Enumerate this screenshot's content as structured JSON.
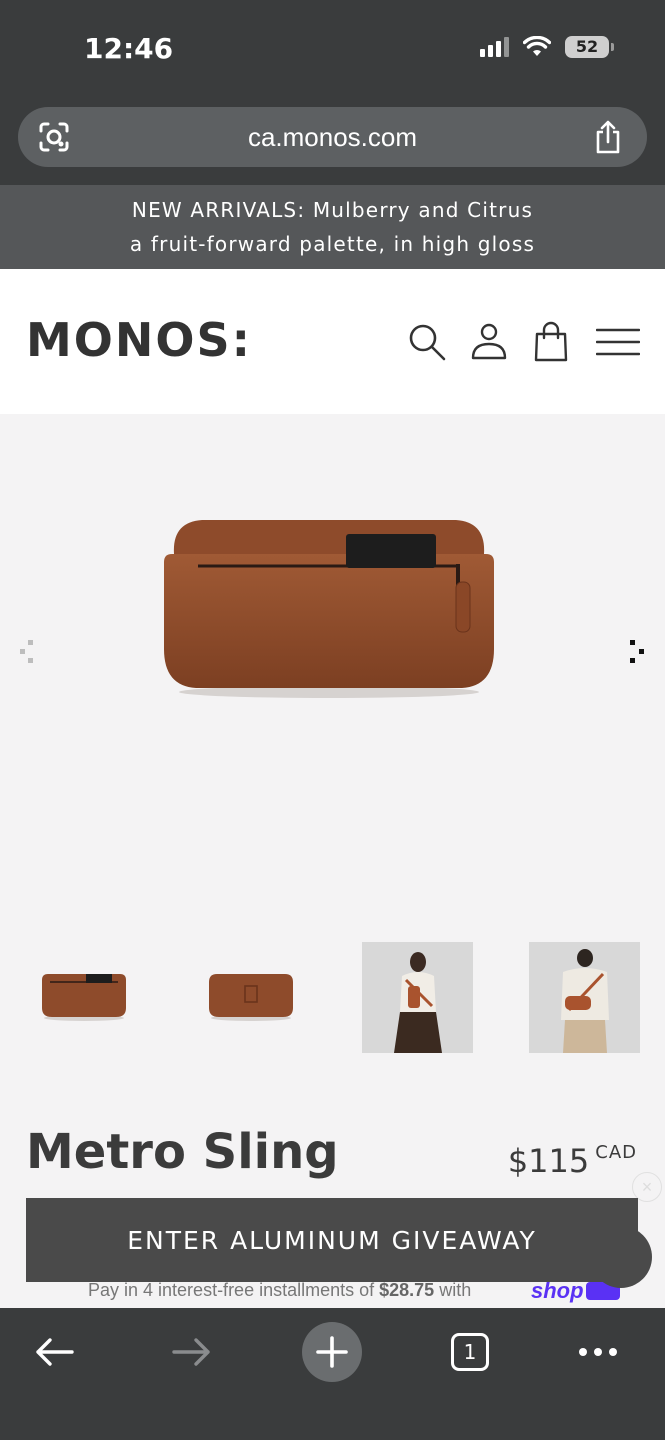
{
  "status_bar": {
    "time": "12:46",
    "battery": "52"
  },
  "browser": {
    "url": "ca.monos.com",
    "tab_count": "1"
  },
  "promo": {
    "line1": "NEW ARRIVALS: Mulberry and Citrus",
    "line2": "a fruit-forward palette, in high gloss"
  },
  "header": {
    "logo": "MONOS:",
    "icons": [
      "search-icon",
      "account-icon",
      "cart-icon",
      "menu-icon"
    ]
  },
  "product": {
    "title": "Metro Sling",
    "price": "$115",
    "currency": "CAD",
    "installments_prefix": "Pay in 4 interest-free installments of ",
    "installments_amount": "$28.75",
    "installments_suffix": " with",
    "pay_brand": "shop"
  },
  "cta": {
    "label": "ENTER ALUMINUM GIVEAWAY"
  },
  "colors": {
    "leather": "#8b4a2b",
    "chrome": "#3a3c3d",
    "shop_pay": "#5a31f4"
  }
}
